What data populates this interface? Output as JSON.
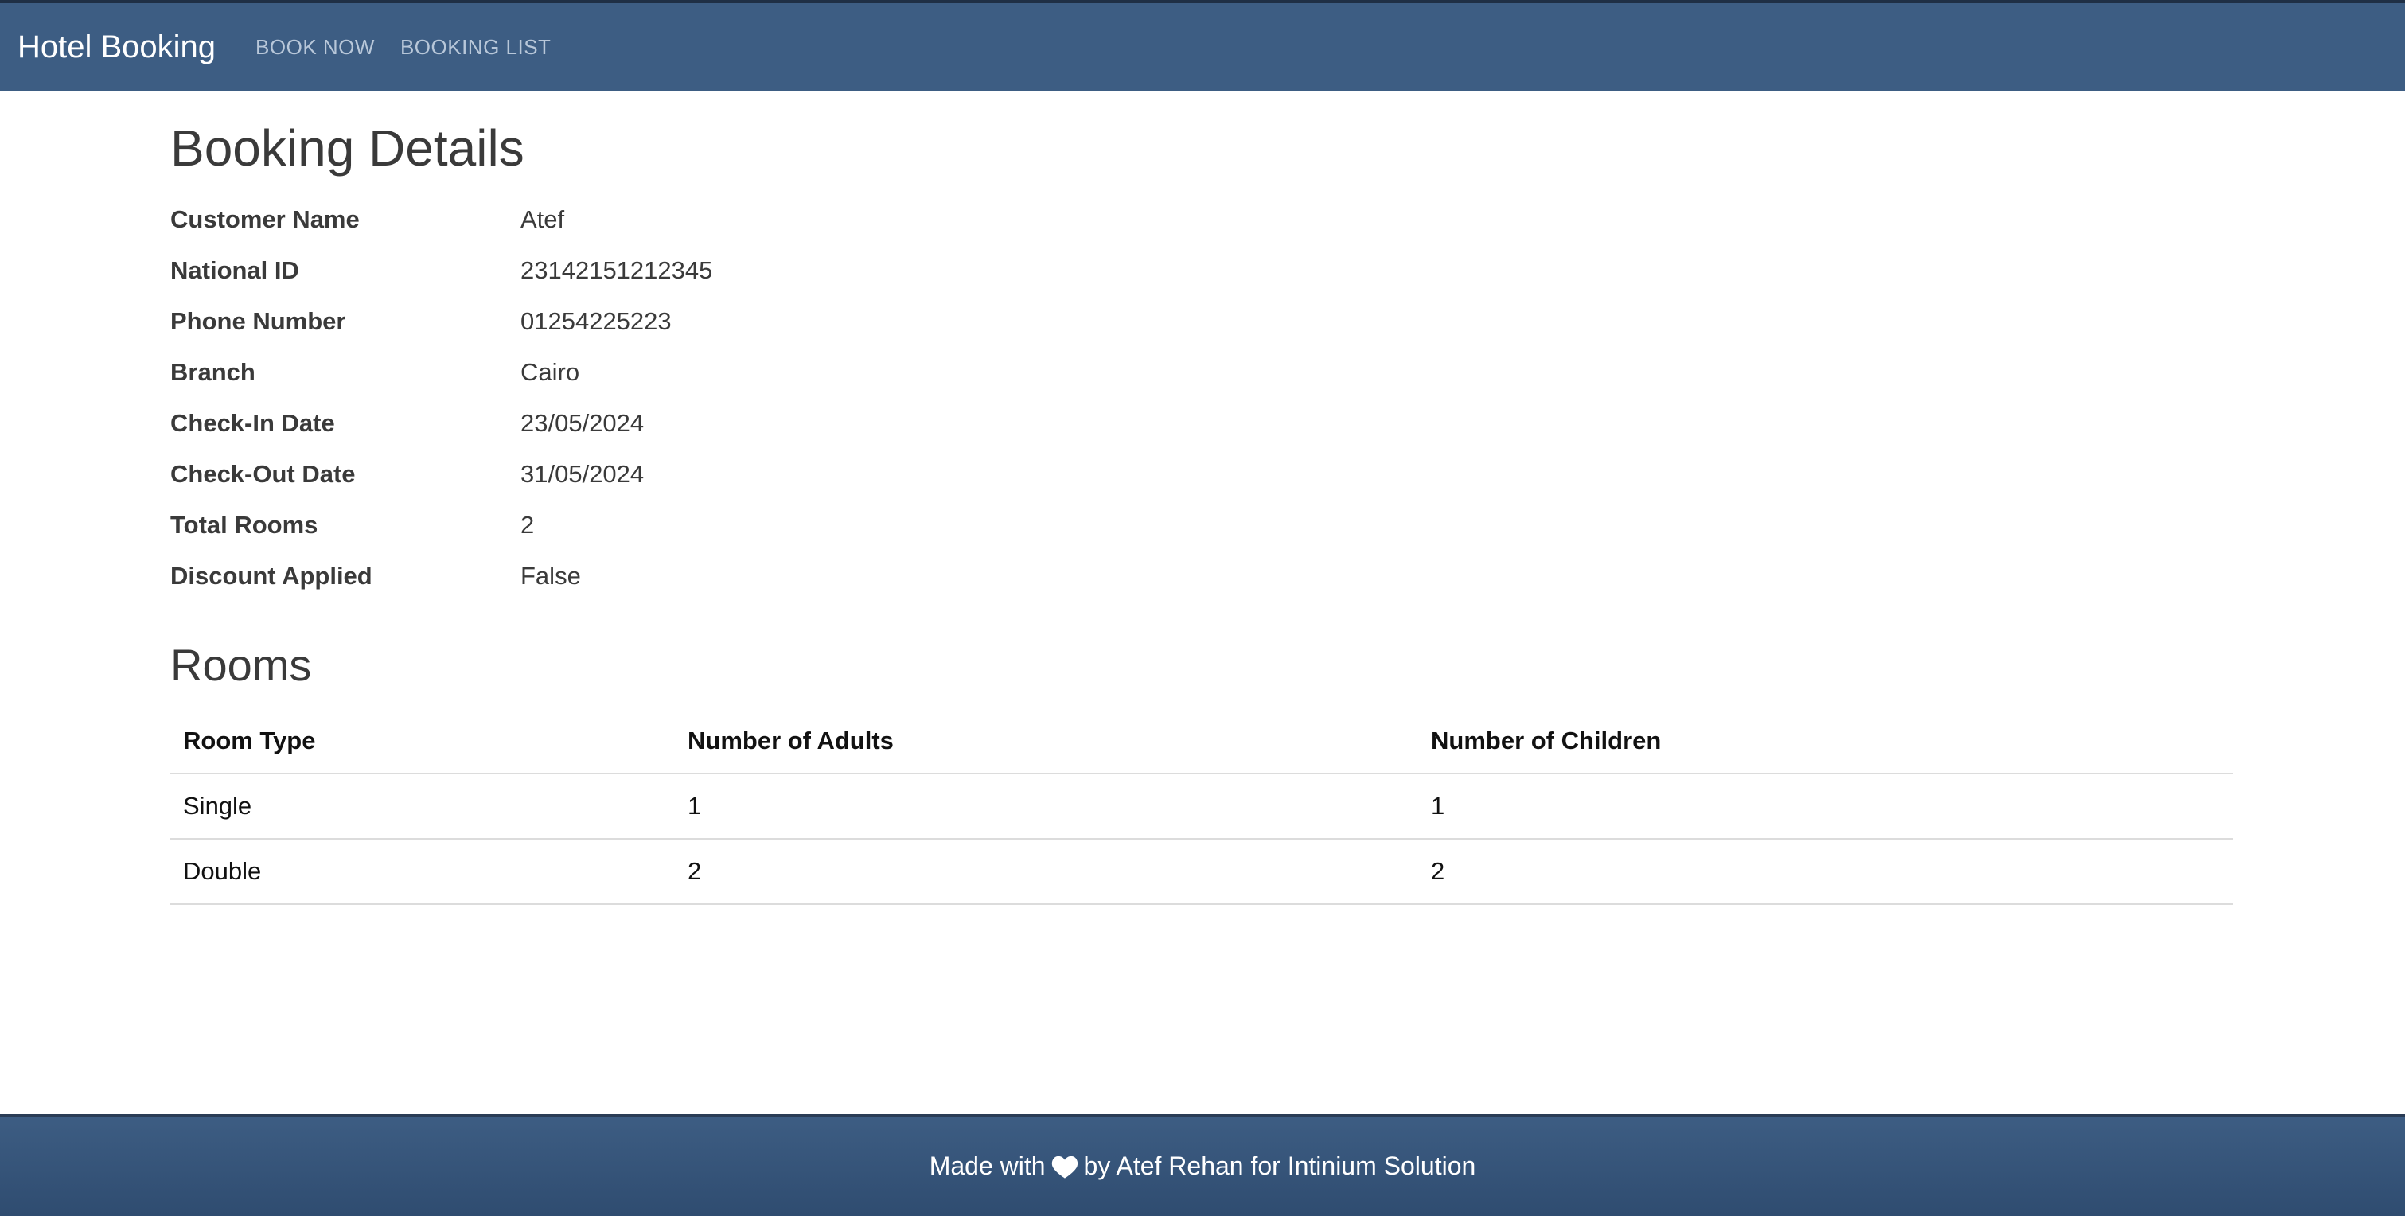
{
  "navbar": {
    "brand": "Hotel Booking",
    "links": [
      "BOOK NOW",
      "BOOKING LIST"
    ],
    "background": "#3d5d83"
  },
  "main": {
    "title": "Booking Details",
    "details": [
      {
        "label": "Customer Name",
        "value": "Atef"
      },
      {
        "label": "National ID",
        "value": "23142151212345"
      },
      {
        "label": "Phone Number",
        "value": "01254225223"
      },
      {
        "label": "Branch",
        "value": "Cairo"
      },
      {
        "label": "Check-In Date",
        "value": "23/05/2024"
      },
      {
        "label": "Check-Out Date",
        "value": "31/05/2024"
      },
      {
        "label": "Total Rooms",
        "value": "2"
      },
      {
        "label": "Discount Applied",
        "value": "False"
      }
    ],
    "rooms_title": "Rooms",
    "rooms_table": {
      "headers": [
        "Room Type",
        "Number of Adults",
        "Number of Children"
      ],
      "rows": [
        [
          "Single",
          "1",
          "1"
        ],
        [
          "Double",
          "2",
          "2"
        ]
      ]
    }
  },
  "footer": {
    "prefix": "Made with",
    "icon": "heart-icon",
    "suffix": "by Atef Rehan for Intinium Solution"
  }
}
